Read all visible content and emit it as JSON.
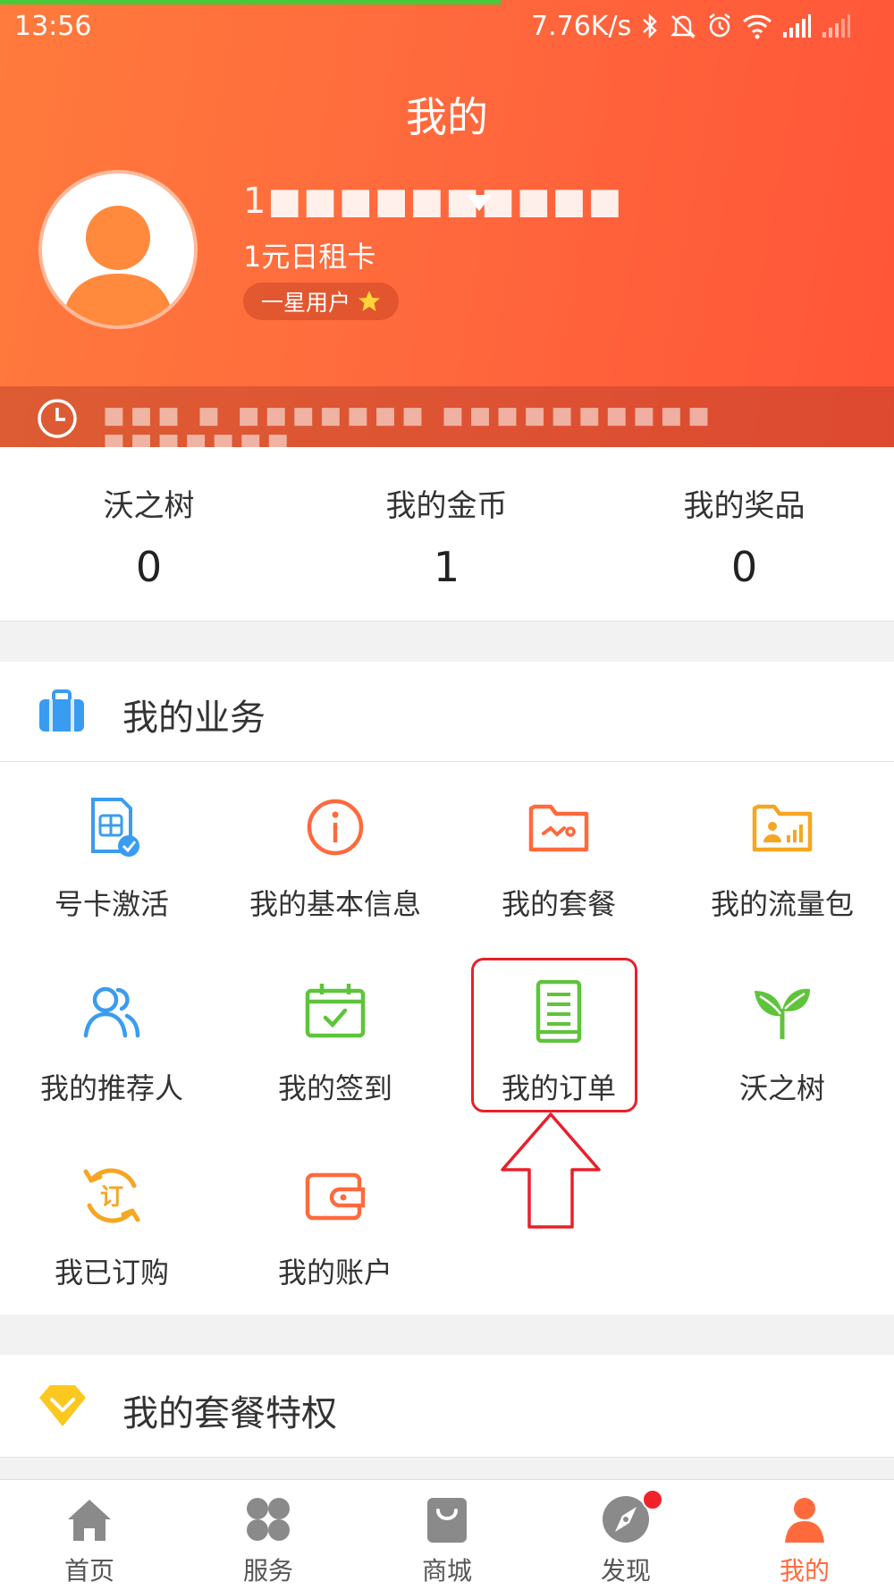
{
  "status_bar": {
    "time": "13:56",
    "speed": "7.76K/s",
    "icons": [
      "bluetooth-icon",
      "mute-icon",
      "alarm-icon",
      "wifi-icon",
      "signal-icon",
      "signal-icon"
    ]
  },
  "header": {
    "title": "我的",
    "phone_number": "1■■■■■■■■■■",
    "plan_name": "1元日租卡",
    "user_level": "一星用户",
    "notice_text": "■■■ ■ ■■■■■■■ ■■■■■■■■■■ ■■■■■■■",
    "accent_color": "#ff6a3d"
  },
  "stats": [
    {
      "label": "沃之树",
      "value": "0"
    },
    {
      "label": "我的金币",
      "value": "1"
    },
    {
      "label": "我的奖品",
      "value": "0"
    }
  ],
  "business": {
    "title": "我的业务",
    "items": [
      {
        "label": "号卡激活",
        "icon": "sim-card-check-icon"
      },
      {
        "label": "我的基本信息",
        "icon": "info-icon"
      },
      {
        "label": "我的套餐",
        "icon": "package-folder-icon"
      },
      {
        "label": "我的流量包",
        "icon": "data-folder-icon"
      },
      {
        "label": "我的推荐人",
        "icon": "referrer-users-icon"
      },
      {
        "label": "我的签到",
        "icon": "calendar-check-icon"
      },
      {
        "label": "我的订单",
        "icon": "order-list-icon"
      },
      {
        "label": "沃之树",
        "icon": "sprout-icon"
      },
      {
        "label": "我已订购",
        "icon": "subscribed-icon"
      },
      {
        "label": "我的账户",
        "icon": "wallet-icon"
      }
    ]
  },
  "privilege": {
    "title": "我的套餐特权"
  },
  "tabbar": [
    {
      "label": "首页",
      "icon": "home-icon",
      "active": false
    },
    {
      "label": "服务",
      "icon": "services-icon",
      "active": false
    },
    {
      "label": "商城",
      "icon": "shopping-bag-icon",
      "active": false
    },
    {
      "label": "发现",
      "icon": "compass-icon",
      "active": false
    },
    {
      "label": "我的",
      "icon": "profile-icon",
      "active": true
    }
  ]
}
